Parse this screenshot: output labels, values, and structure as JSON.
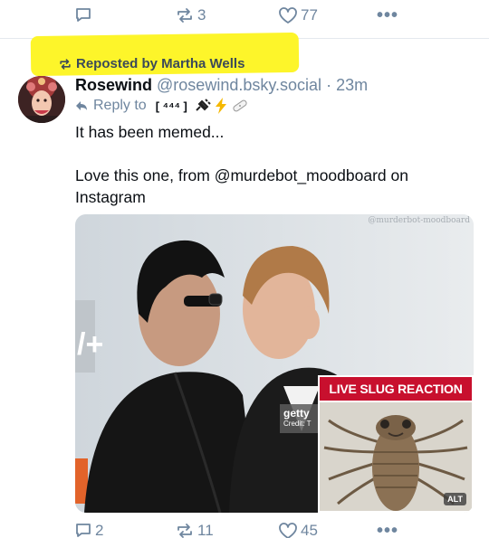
{
  "top_actions": {
    "replies": "",
    "reposts": "3",
    "likes": "77",
    "more": "•••"
  },
  "repost_line": {
    "text": "Reposted by Martha Wells"
  },
  "post": {
    "author_name": "Rosewind",
    "author_handle": "@rosewind.bsky.social",
    "separator": "·",
    "time": "23m",
    "reply_prefix": "Reply to",
    "reply_badge": "[ ⁴⁴⁴ ]",
    "text_line1": "It has been memed...",
    "text_line2": "Love this one, from @murdebot_moodboard on Instagram",
    "image": {
      "watermark": "@murderbot-moodboard",
      "getty_text": "getty",
      "getty_credit": "Credit: T",
      "inset_title": "LIVE SLUG REACTION",
      "alt_badge": "ALT"
    }
  },
  "bottom_actions": {
    "replies": "2",
    "reposts": "11",
    "likes": "45",
    "more": "•••"
  },
  "colors": {
    "highlight": "#fdf52a",
    "icon": "#6f869f",
    "inset_red": "#c8102e"
  }
}
